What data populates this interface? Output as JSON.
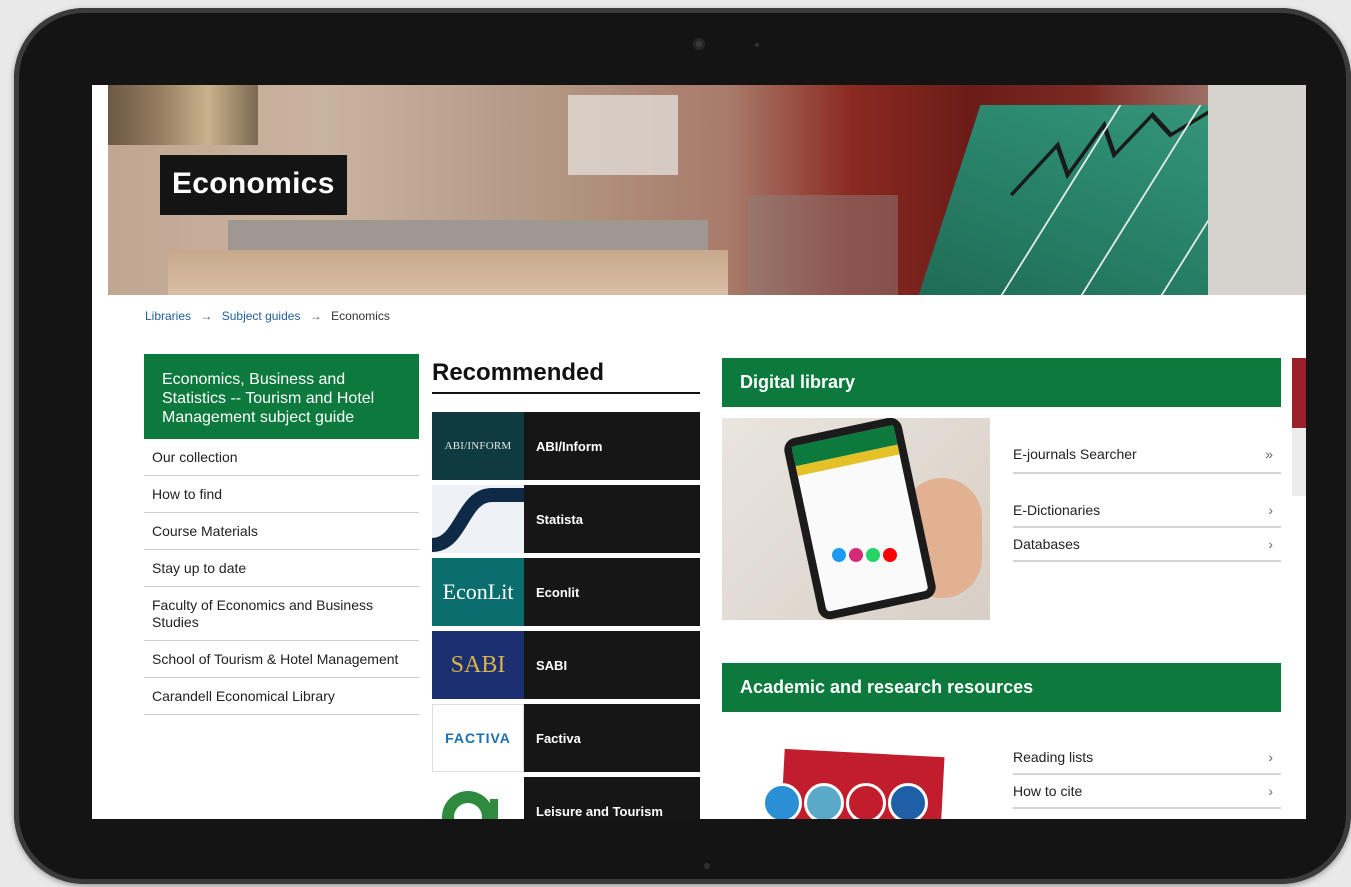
{
  "hero": {
    "title": "Economics"
  },
  "breadcrumb": {
    "items": [
      "Libraries",
      "Subject guides",
      "Economics"
    ],
    "separator": "→"
  },
  "leftnav": {
    "header": "Economics, Business and Statistics -- Tourism and Hotel Management subject guide",
    "items": [
      "Our collection",
      "How to find",
      "Course Materials",
      "Stay up to date",
      "Faculty of Economics and Business Studies",
      "School of Tourism & Hotel Management",
      "Carandell Economical Library"
    ]
  },
  "recommended": {
    "title": "Recommended",
    "items": [
      {
        "label": "ABI/Inform",
        "logo_text": "ABI/INFORM"
      },
      {
        "label": "Statista",
        "logo_text": ""
      },
      {
        "label": "Econlit",
        "logo_text": "EconLit"
      },
      {
        "label": "SABI",
        "logo_text": "SABI"
      },
      {
        "label": "Factiva",
        "logo_text": "FACTIVA"
      },
      {
        "label": "Leisure and Tourism",
        "logo_text": ""
      }
    ]
  },
  "digital_library": {
    "title": "Digital library",
    "links": [
      {
        "label": "E-journals Searcher",
        "chevron": "»"
      },
      {
        "label": "E-Dictionaries",
        "chevron": "›"
      },
      {
        "label": "Databases",
        "chevron": "›"
      }
    ]
  },
  "academic": {
    "title": "Academic and research resources",
    "links": [
      {
        "label": "Reading lists",
        "chevron": "›"
      },
      {
        "label": "How to cite",
        "chevron": "›"
      }
    ]
  },
  "colors": {
    "brand_green": "#0b7a3c",
    "card_dark": "#161616",
    "link_blue": "#1f5e9c"
  }
}
